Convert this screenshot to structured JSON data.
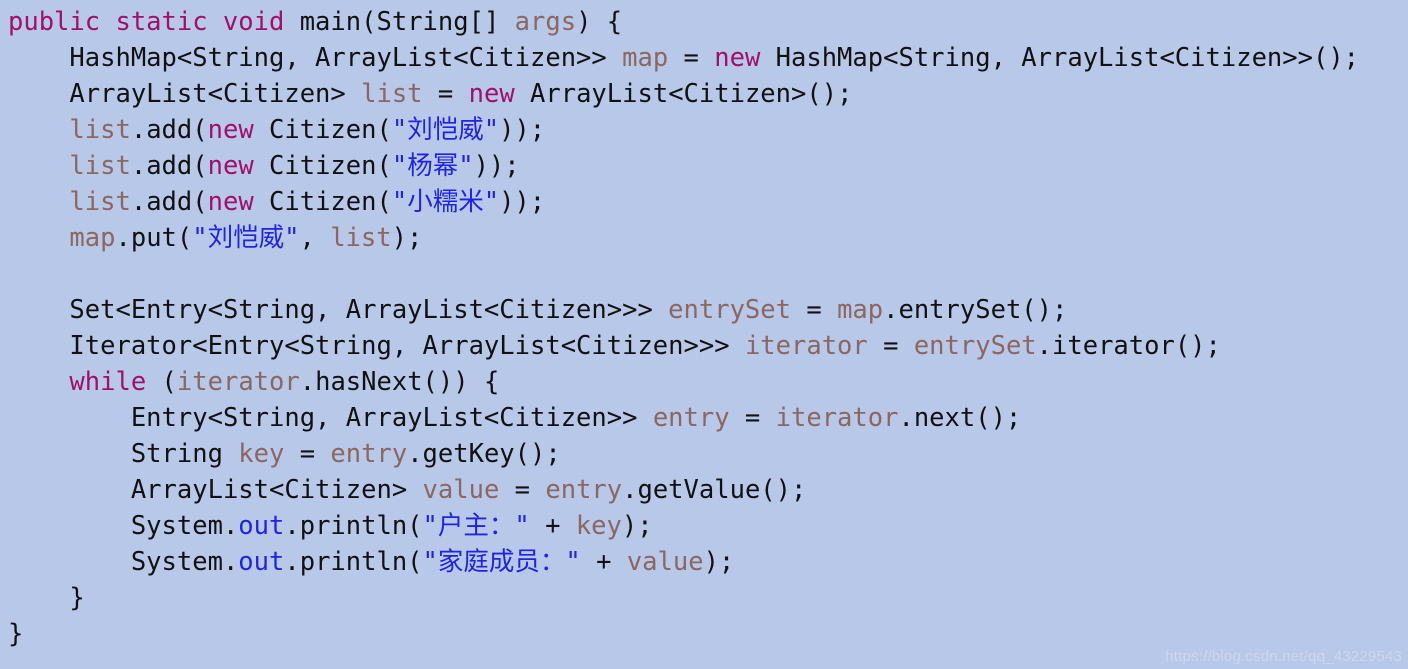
{
  "document": {
    "type": "java-code-snippet",
    "language": "Java",
    "background_color": "#b8c8e8",
    "font_size_px": 25.5,
    "line_height_px": 36
  },
  "theme": {
    "keyword_color": "#a0106a",
    "type_color": "#111111",
    "variable_color": "#8c6660",
    "string_color": "#2222e2",
    "field_color": "#2222e2",
    "plain_color": "#111111",
    "watermark_color": "#ccd7ef"
  },
  "code": {
    "lines": [
      {
        "index": 1,
        "indent": 0,
        "text": "public static void main(String[] args) {",
        "tokens": [
          {
            "t": "public static void ",
            "c": "kw"
          },
          {
            "t": "main",
            "c": "type"
          },
          {
            "t": "(",
            "c": "plain"
          },
          {
            "t": "String",
            "c": "type"
          },
          {
            "t": "[] ",
            "c": "plain"
          },
          {
            "t": "args",
            "c": "var"
          },
          {
            "t": ") {",
            "c": "plain"
          }
        ]
      },
      {
        "index": 2,
        "indent": 1,
        "text": "HashMap<String, ArrayList<Citizen>> map = new HashMap<String, ArrayList<Citizen>>();",
        "tokens": [
          {
            "t": "HashMap<String, ArrayList<Citizen>> ",
            "c": "type"
          },
          {
            "t": "map",
            "c": "var"
          },
          {
            "t": " = ",
            "c": "plain"
          },
          {
            "t": "new",
            "c": "kw"
          },
          {
            "t": " HashMap<String, ArrayList<Citizen>>();",
            "c": "type"
          }
        ]
      },
      {
        "index": 3,
        "indent": 1,
        "text": "ArrayList<Citizen> list = new ArrayList<Citizen>();",
        "tokens": [
          {
            "t": "ArrayList<Citizen> ",
            "c": "type"
          },
          {
            "t": "list",
            "c": "var"
          },
          {
            "t": " = ",
            "c": "plain"
          },
          {
            "t": "new",
            "c": "kw"
          },
          {
            "t": " ArrayList<Citizen>();",
            "c": "type"
          }
        ]
      },
      {
        "index": 4,
        "indent": 1,
        "text": "list.add(new Citizen(\"刘恺威\"));",
        "tokens": [
          {
            "t": "list",
            "c": "var"
          },
          {
            "t": ".add(",
            "c": "plain"
          },
          {
            "t": "new",
            "c": "kw"
          },
          {
            "t": " Citizen(",
            "c": "type"
          },
          {
            "t": "\"刘恺威\"",
            "c": "str"
          },
          {
            "t": "));",
            "c": "plain"
          }
        ]
      },
      {
        "index": 5,
        "indent": 1,
        "text": "list.add(new Citizen(\"杨幂\"));",
        "tokens": [
          {
            "t": "list",
            "c": "var"
          },
          {
            "t": ".add(",
            "c": "plain"
          },
          {
            "t": "new",
            "c": "kw"
          },
          {
            "t": " Citizen(",
            "c": "type"
          },
          {
            "t": "\"杨幂\"",
            "c": "str"
          },
          {
            "t": "));",
            "c": "plain"
          }
        ]
      },
      {
        "index": 6,
        "indent": 1,
        "text": "list.add(new Citizen(\"小糯米\"));",
        "tokens": [
          {
            "t": "list",
            "c": "var"
          },
          {
            "t": ".add(",
            "c": "plain"
          },
          {
            "t": "new",
            "c": "kw"
          },
          {
            "t": " Citizen(",
            "c": "type"
          },
          {
            "t": "\"小糯米\"",
            "c": "str"
          },
          {
            "t": "));",
            "c": "plain"
          }
        ]
      },
      {
        "index": 7,
        "indent": 1,
        "text": "map.put(\"刘恺威\", list);",
        "tokens": [
          {
            "t": "map",
            "c": "var"
          },
          {
            "t": ".put(",
            "c": "plain"
          },
          {
            "t": "\"刘恺威\"",
            "c": "str"
          },
          {
            "t": ", ",
            "c": "plain"
          },
          {
            "t": "list",
            "c": "var"
          },
          {
            "t": ");",
            "c": "plain"
          }
        ]
      },
      {
        "index": 8,
        "indent": 0,
        "text": "",
        "tokens": []
      },
      {
        "index": 9,
        "indent": 1,
        "text": "Set<Entry<String, ArrayList<Citizen>>> entrySet = map.entrySet();",
        "tokens": [
          {
            "t": "Set<Entry<String, ArrayList<Citizen>>> ",
            "c": "type"
          },
          {
            "t": "entrySet",
            "c": "var"
          },
          {
            "t": " = ",
            "c": "plain"
          },
          {
            "t": "map",
            "c": "var"
          },
          {
            "t": ".entrySet();",
            "c": "plain"
          }
        ]
      },
      {
        "index": 10,
        "indent": 1,
        "text": "Iterator<Entry<String, ArrayList<Citizen>>> iterator = entrySet.iterator();",
        "tokens": [
          {
            "t": "Iterator<Entry<String, ArrayList<Citizen>>> ",
            "c": "type"
          },
          {
            "t": "iterator",
            "c": "var"
          },
          {
            "t": " = ",
            "c": "plain"
          },
          {
            "t": "entrySet",
            "c": "var"
          },
          {
            "t": ".iterator();",
            "c": "plain"
          }
        ]
      },
      {
        "index": 11,
        "indent": 1,
        "text": "while (iterator.hasNext()) {",
        "tokens": [
          {
            "t": "while",
            "c": "kw"
          },
          {
            "t": " (",
            "c": "plain"
          },
          {
            "t": "iterator",
            "c": "var"
          },
          {
            "t": ".hasNext()) {",
            "c": "plain"
          }
        ]
      },
      {
        "index": 12,
        "indent": 2,
        "text": "Entry<String, ArrayList<Citizen>> entry = iterator.next();",
        "tokens": [
          {
            "t": "Entry<String, ArrayList<Citizen>> ",
            "c": "type"
          },
          {
            "t": "entry",
            "c": "var"
          },
          {
            "t": " = ",
            "c": "plain"
          },
          {
            "t": "iterator",
            "c": "var"
          },
          {
            "t": ".next();",
            "c": "plain"
          }
        ]
      },
      {
        "index": 13,
        "indent": 2,
        "text": "String key = entry.getKey();",
        "tokens": [
          {
            "t": "String ",
            "c": "type"
          },
          {
            "t": "key",
            "c": "var"
          },
          {
            "t": " = ",
            "c": "plain"
          },
          {
            "t": "entry",
            "c": "var"
          },
          {
            "t": ".getKey();",
            "c": "plain"
          }
        ]
      },
      {
        "index": 14,
        "indent": 2,
        "text": "ArrayList<Citizen> value = entry.getValue();",
        "tokens": [
          {
            "t": "ArrayList<Citizen> ",
            "c": "type"
          },
          {
            "t": "value",
            "c": "var"
          },
          {
            "t": " = ",
            "c": "plain"
          },
          {
            "t": "entry",
            "c": "var"
          },
          {
            "t": ".getValue();",
            "c": "plain"
          }
        ]
      },
      {
        "index": 15,
        "indent": 2,
        "text": "System.out.println(\"户主：\" + key);",
        "tokens": [
          {
            "t": "System.",
            "c": "plain"
          },
          {
            "t": "out",
            "c": "fld"
          },
          {
            "t": ".println(",
            "c": "plain"
          },
          {
            "t": "\"户主：\"",
            "c": "str"
          },
          {
            "t": " + ",
            "c": "plain"
          },
          {
            "t": "key",
            "c": "var"
          },
          {
            "t": ");",
            "c": "plain"
          }
        ]
      },
      {
        "index": 16,
        "indent": 2,
        "text": "System.out.println(\"家庭成员：\" + value);",
        "tokens": [
          {
            "t": "System.",
            "c": "plain"
          },
          {
            "t": "out",
            "c": "fld"
          },
          {
            "t": ".println(",
            "c": "plain"
          },
          {
            "t": "\"家庭成员：\"",
            "c": "str"
          },
          {
            "t": " + ",
            "c": "plain"
          },
          {
            "t": "value",
            "c": "var"
          },
          {
            "t": ");",
            "c": "plain"
          }
        ]
      },
      {
        "index": 17,
        "indent": 1,
        "text": "}",
        "tokens": [
          {
            "t": "}",
            "c": "plain"
          }
        ]
      },
      {
        "index": 18,
        "indent": 0,
        "text": "}",
        "tokens": [
          {
            "t": "}",
            "c": "plain"
          }
        ]
      }
    ]
  },
  "watermark": {
    "text": "https://blog.csdn.net/qq_43229543"
  }
}
